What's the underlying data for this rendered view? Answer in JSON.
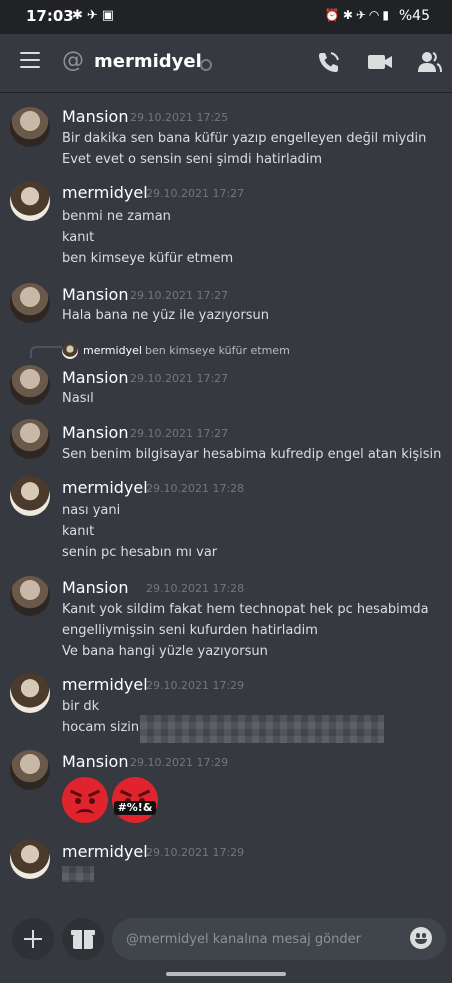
{
  "status_bar": {
    "time": "17:03",
    "battery": "%45"
  },
  "header": {
    "channel_name": "mermidyel"
  },
  "messages": [
    {
      "author": "Mansion",
      "timestamp": "29.10.2021 17:25",
      "lines": [
        "Bir dakika sen bana küfür yazıp engelleyen değil miydin",
        "Evet evet o sensin seni şimdi hatirladim"
      ]
    },
    {
      "author": "mermidyel",
      "timestamp": "29.10.2021 17:27",
      "lines": [
        "benmi ne zaman",
        "kanıt",
        "ben kimseye küfür etmem"
      ]
    },
    {
      "author": "Mansion",
      "timestamp": "29.10.2021 17:27",
      "lines": [
        "Hala bana ne yüz ile yazıyorsun"
      ]
    },
    {
      "reply_to": {
        "author": "mermidyel",
        "text": "ben kimseye küfür etmem"
      },
      "author": "Mansion",
      "timestamp": "29.10.2021 17:27",
      "lines": [
        "Nasıl"
      ]
    },
    {
      "author": "Mansion",
      "timestamp": "29.10.2021 17:27",
      "lines": [
        "Sen benim bilgisayar hesabima kufredip engel atan kişisin"
      ]
    },
    {
      "author": "mermidyel",
      "timestamp": "29.10.2021 17:28",
      "lines": [
        "nası yani",
        "kanıt",
        "senin pc hesabın mı var"
      ]
    },
    {
      "author": "Mansion",
      "timestamp": "29.10.2021 17:28",
      "lines": [
        "Kanıt yok sildim fakat hem technopat hek pc hesabimda",
        "engelliymişsin seni kufurden hatirladim",
        "Ve bana hangi yüzle yazıyorsun"
      ]
    },
    {
      "author": "mermidyel",
      "timestamp": "29.10.2021 17:29",
      "lines": [
        "bir dk",
        "hocam sizin a"
      ]
    },
    {
      "author": "Mansion",
      "timestamp": "29.10.2021 17:29",
      "emojis": [
        "angry-face-emoji",
        "cursing-face-emoji"
      ],
      "cursing_text": "#%!&"
    },
    {
      "author": "mermidyel",
      "timestamp": "29.10.2021 17:29"
    }
  ],
  "composer": {
    "placeholder": "@mermidyel kanalına mesaj gönder"
  },
  "colors": {
    "background": "#36393f",
    "topbar": "#202225",
    "input": "#40444b",
    "emoji_red": "#e0242e"
  }
}
